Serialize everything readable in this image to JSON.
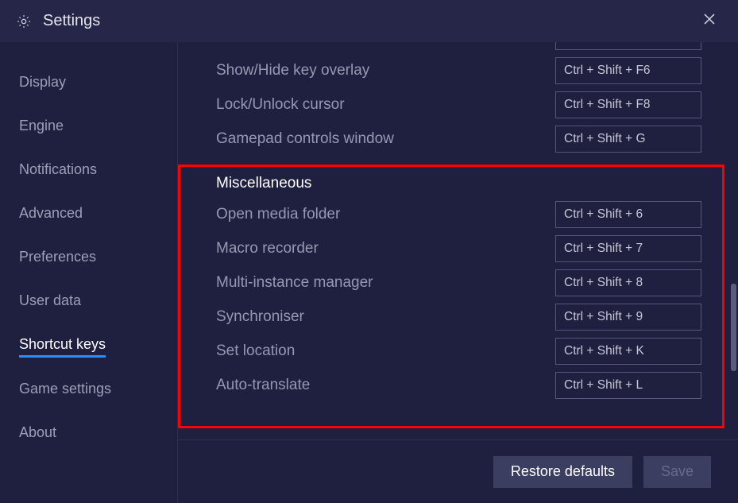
{
  "title": "Settings",
  "sidebar": {
    "items": [
      {
        "label": "Display"
      },
      {
        "label": "Engine"
      },
      {
        "label": "Notifications"
      },
      {
        "label": "Advanced"
      },
      {
        "label": "Preferences"
      },
      {
        "label": "User data"
      },
      {
        "label": "Shortcut keys",
        "active": true
      },
      {
        "label": "Game settings"
      },
      {
        "label": "About"
      }
    ]
  },
  "top_rows": [
    {
      "label": "Show/Hide key overlay",
      "value": "Ctrl + Shift + F6"
    },
    {
      "label": "Lock/Unlock cursor",
      "value": "Ctrl + Shift + F8"
    },
    {
      "label": "Gamepad controls window",
      "value": "Ctrl + Shift + G"
    }
  ],
  "misc_title": "Miscellaneous",
  "misc_rows": [
    {
      "label": "Open media folder",
      "value": "Ctrl + Shift + 6"
    },
    {
      "label": "Macro recorder",
      "value": "Ctrl + Shift + 7"
    },
    {
      "label": "Multi-instance manager",
      "value": "Ctrl + Shift + 8"
    },
    {
      "label": "Synchroniser",
      "value": "Ctrl + Shift + 9"
    },
    {
      "label": "Set location",
      "value": "Ctrl + Shift + K"
    },
    {
      "label": "Auto-translate",
      "value": "Ctrl + Shift + L"
    }
  ],
  "footer": {
    "restore": "Restore defaults",
    "save": "Save"
  }
}
